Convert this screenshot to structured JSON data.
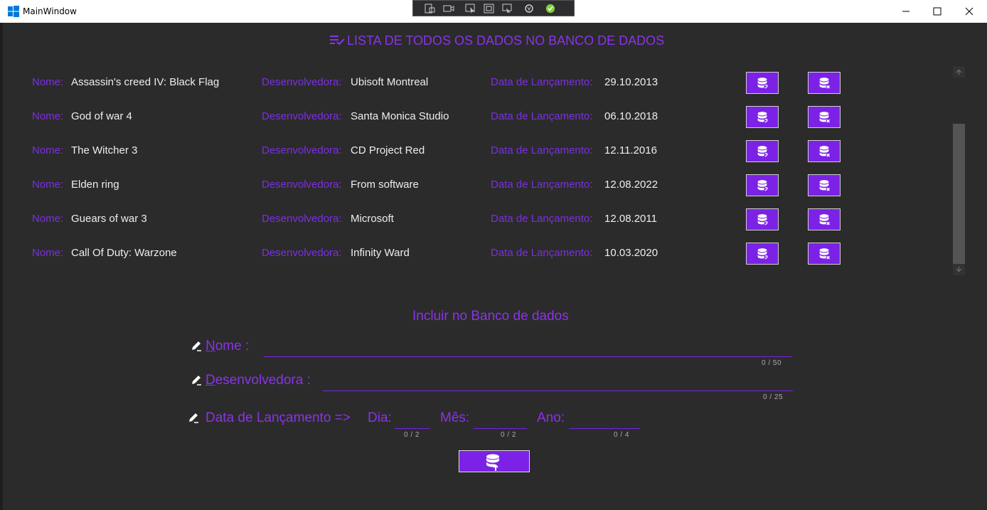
{
  "window": {
    "title": "MainWindow"
  },
  "header": {
    "title": "LISTA DE TODOS OS DADOS NO BANCO DE DADOS"
  },
  "labels": {
    "name": "Nome:",
    "developer": "Desenvolvedora:",
    "release": "Data de Lançamento:"
  },
  "games": [
    {
      "name": "Assassin's creed IV: Black Flag",
      "developer": "Ubisoft Montreal",
      "release": "29.10.2013"
    },
    {
      "name": "God of war 4",
      "developer": "Santa Monica Studio",
      "release": "06.10.2018"
    },
    {
      "name": "The Witcher 3",
      "developer": "CD Project Red",
      "release": "12.11.2016"
    },
    {
      "name": "Elden ring",
      "developer": "From software",
      "release": "12.08.2022"
    },
    {
      "name": "Guears of war 3",
      "developer": "Microsoft",
      "release": "12.08.2011"
    },
    {
      "name": "Call Of Duty: Warzone",
      "developer": "Infinity Ward",
      "release": "10.03.2020"
    }
  ],
  "form": {
    "title": "Incluir no Banco de dados",
    "name_label_first": "N",
    "name_label_rest": "ome :",
    "name_counter": "0 / 50",
    "developer_label_first": "D",
    "developer_label_rest": "esenvolvedora :",
    "developer_counter": "0 / 25",
    "release_label": "Data de Lançamento =>",
    "day_label": "Dia:",
    "day_counter": "0 / 2",
    "month_label": "Mês:",
    "month_counter": "0 / 2",
    "year_label": "Ano:",
    "year_counter": "0 / 4"
  },
  "colors": {
    "accent": "#7b22e6",
    "background": "#2b2b2b",
    "text": "#eeeeee"
  },
  "icons": {
    "edit_row": "database-edit-icon",
    "delete_row": "database-remove-icon",
    "submit": "database-upload-icon",
    "field": "pencil-icon"
  }
}
